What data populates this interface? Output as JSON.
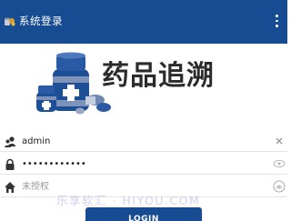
{
  "app_bar": {
    "title": "系统登录",
    "logo_icon": "pill-bottle-logo-icon",
    "menu_icon": "more-vert-icon",
    "background": "#174c92"
  },
  "banner": {
    "brand_text": "药品追溯",
    "illustration": "medicine-bottles-and-pills"
  },
  "form": {
    "username": {
      "value": "admin",
      "icon": "users-icon",
      "clear_icon": "clear-x-icon"
    },
    "password": {
      "value": "••••••••••••",
      "icon": "lock-icon",
      "toggle_icon": "eye-icon"
    },
    "authorization": {
      "placeholder": "未授权",
      "icon": "home-icon",
      "action_icon": "fingerprint-icon"
    }
  },
  "login_button": {
    "label": "LOGIN"
  },
  "watermark": {
    "text": "乐享软汇 · HIYOU.COM"
  }
}
